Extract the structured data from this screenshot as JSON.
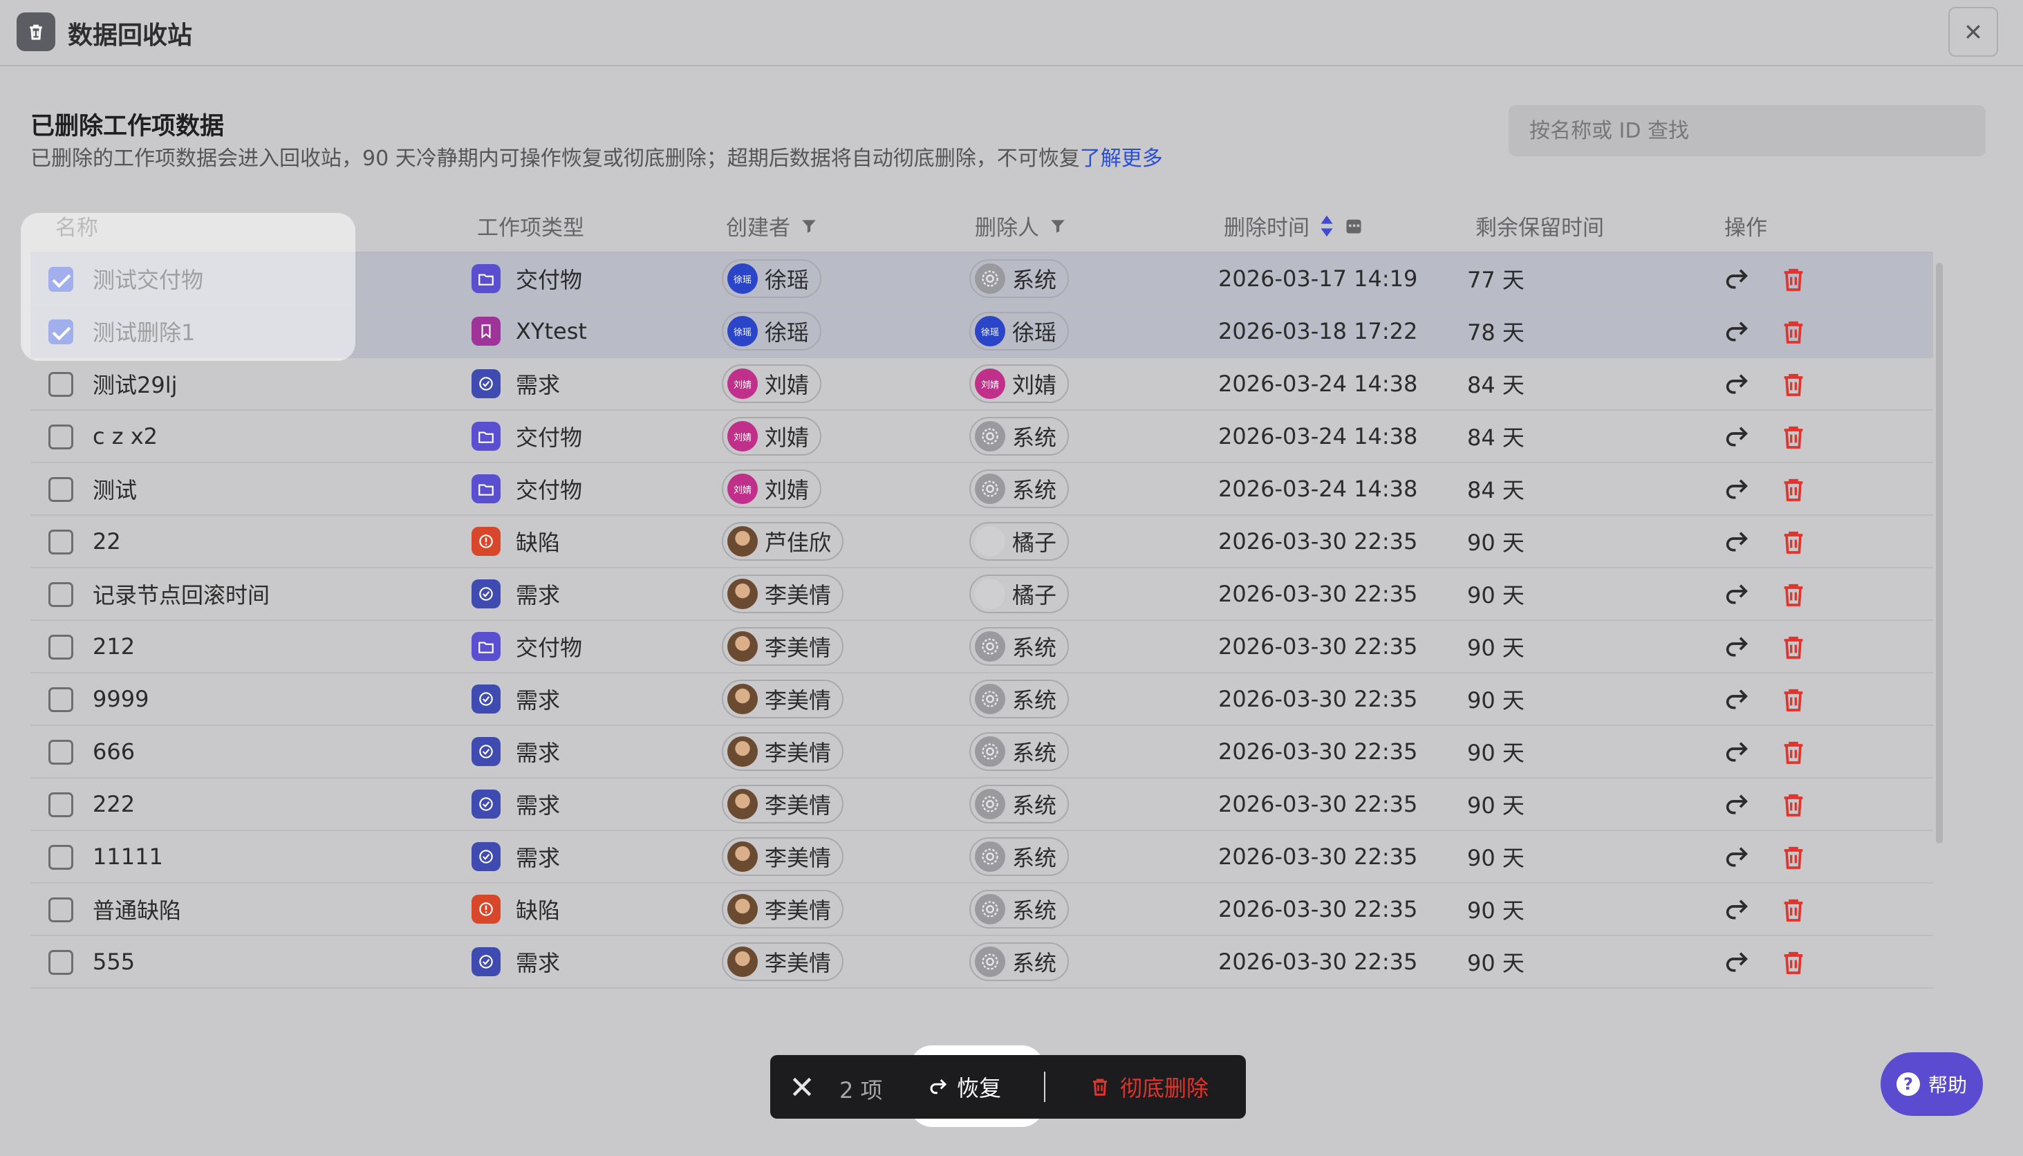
{
  "window": {
    "title": "数据回收站",
    "close_label": "✕"
  },
  "header": {
    "title": "已删除工作项数据",
    "description": "已删除的工作项数据会进入回收站，90 天冷静期内可操作恢复或彻底删除；超期后数据将自动彻底删除，不可恢复",
    "learn_more": "了解更多",
    "search_placeholder": "按名称或 ID 查找"
  },
  "columns": {
    "name": "名称",
    "type": "工作项类型",
    "creator": "创建者",
    "deleter": "删除人",
    "deleted_at": "删除时间",
    "remaining": "剩余保留时间",
    "actions": "操作"
  },
  "type_colors": {
    "交付物": "#5a4fd0",
    "XYtest": "#a0339a",
    "需求": "#3f4bb0",
    "缺陷": "#d9472b"
  },
  "rows": [
    {
      "name": "测试交付物",
      "type": "交付物",
      "creator": "徐瑶",
      "creator_avatar": "徐瑶",
      "deleter": "系统",
      "deleted_at": "2026-03-17 14:19",
      "remaining": "77 天",
      "checked": true
    },
    {
      "name": "测试删除1",
      "type": "XYtest",
      "creator": "徐瑶",
      "creator_avatar": "徐瑶",
      "deleter": "徐瑶",
      "deleted_at": "2026-03-18 17:22",
      "remaining": "78 天",
      "checked": true
    },
    {
      "name": "测试29lj",
      "type": "需求",
      "creator": "刘婧",
      "creator_avatar": "刘婧",
      "deleter": "刘婧",
      "deleted_at": "2026-03-24 14:38",
      "remaining": "84 天",
      "checked": false
    },
    {
      "name": "c z x2",
      "type": "交付物",
      "creator": "刘婧",
      "creator_avatar": "刘婧",
      "deleter": "系统",
      "deleted_at": "2026-03-24 14:38",
      "remaining": "84 天",
      "checked": false
    },
    {
      "name": "测试",
      "type": "交付物",
      "creator": "刘婧",
      "creator_avatar": "刘婧",
      "deleter": "系统",
      "deleted_at": "2026-03-24 14:38",
      "remaining": "84 天",
      "checked": false
    },
    {
      "name": "22",
      "type": "缺陷",
      "creator": "芦佳欣",
      "creator_avatar": "",
      "deleter": "橘子",
      "deleted_at": "2026-03-30 22:35",
      "remaining": "90 天",
      "checked": false
    },
    {
      "name": "记录节点回滚时间",
      "type": "需求",
      "creator": "李美情",
      "creator_avatar": "",
      "deleter": "橘子",
      "deleted_at": "2026-03-30 22:35",
      "remaining": "90 天",
      "checked": false
    },
    {
      "name": "212",
      "type": "交付物",
      "creator": "李美情",
      "creator_avatar": "",
      "deleter": "系统",
      "deleted_at": "2026-03-30 22:35",
      "remaining": "90 天",
      "checked": false
    },
    {
      "name": "9999",
      "type": "需求",
      "creator": "李美情",
      "creator_avatar": "",
      "deleter": "系统",
      "deleted_at": "2026-03-30 22:35",
      "remaining": "90 天",
      "checked": false
    },
    {
      "name": "666",
      "type": "需求",
      "creator": "李美情",
      "creator_avatar": "",
      "deleter": "系统",
      "deleted_at": "2026-03-30 22:35",
      "remaining": "90 天",
      "checked": false
    },
    {
      "name": "222",
      "type": "需求",
      "creator": "李美情",
      "creator_avatar": "",
      "deleter": "系统",
      "deleted_at": "2026-03-30 22:35",
      "remaining": "90 天",
      "checked": false
    },
    {
      "name": "11111",
      "type": "需求",
      "creator": "李美情",
      "creator_avatar": "",
      "deleter": "系统",
      "deleted_at": "2026-03-30 22:35",
      "remaining": "90 天",
      "checked": false
    },
    {
      "name": "普通缺陷",
      "type": "缺陷",
      "creator": "李美情",
      "creator_avatar": "",
      "deleter": "系统",
      "deleted_at": "2026-03-30 22:35",
      "remaining": "90 天",
      "checked": false
    },
    {
      "name": "555",
      "type": "需求",
      "creator": "李美情",
      "creator_avatar": "",
      "deleter": "系统",
      "deleted_at": "2026-03-30 22:35",
      "remaining": "90 天",
      "checked": false
    }
  ],
  "bulk_bar": {
    "count": "2 项",
    "restore": "恢复",
    "purge": "彻底删除"
  },
  "help": {
    "label": "帮助"
  }
}
